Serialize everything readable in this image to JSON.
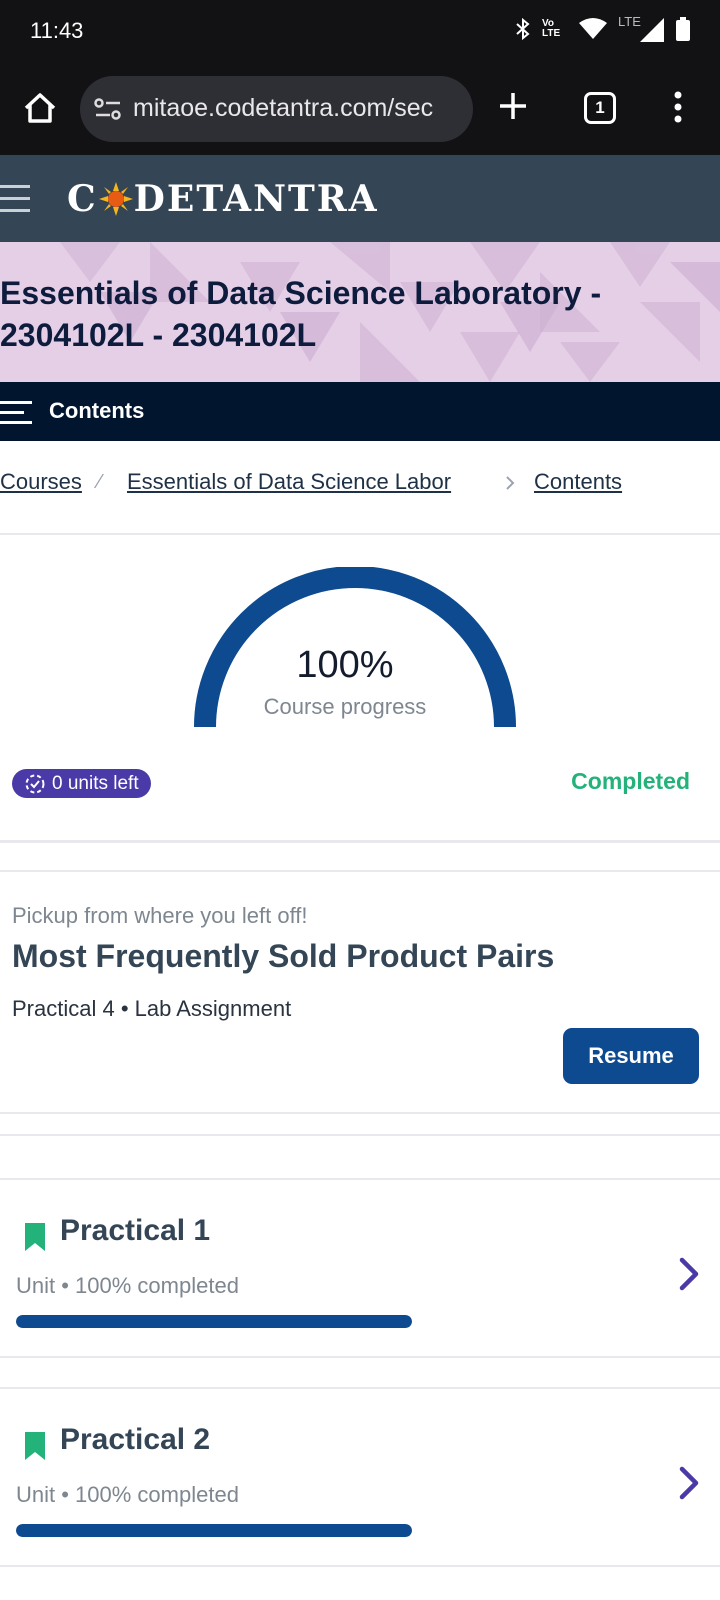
{
  "status_bar": {
    "time": "11:43",
    "icons": [
      "bluetooth-icon",
      "volte-icon",
      "wifi-icon",
      "lte-signal-icon",
      "battery-icon"
    ],
    "lte_label": "LTE",
    "volte_label": "Vo LTE"
  },
  "browser": {
    "url": "mitaoe.codetantra.com/sec",
    "tab_count": "1"
  },
  "app_header": {
    "logo_prefix": "C",
    "logo_suffix": "DETANTRA"
  },
  "course": {
    "title": "Essentials of Data Science Laboratory - 2304102L - 2304102L"
  },
  "contents_bar": {
    "label": "Contents"
  },
  "breadcrumb": [
    {
      "label": "Courses"
    },
    {
      "label": "Essentials of Data Science Labor"
    },
    {
      "label": "Contents"
    }
  ],
  "progress": {
    "value_text": "100%",
    "fraction": 1.0,
    "label": "Course progress",
    "units_left": "0 units left",
    "status": "Completed"
  },
  "pickup": {
    "hint": "Pickup from where you left off!",
    "title": "Most Frequently Sold Product Pairs",
    "meta": "Practical 4 • Lab Assignment",
    "resume_label": "Resume"
  },
  "units": [
    {
      "title": "Practical 1",
      "meta": "Unit • 100% completed",
      "progress": 1.0
    },
    {
      "title": "Practical 2",
      "meta": "Unit • 100% completed",
      "progress": 1.0
    }
  ],
  "colors": {
    "header_bg": "#344556",
    "banner_bg": "#e4cfe6",
    "contents_bg": "#02152f",
    "progress_blue": "#0d4a8f",
    "badge_purple": "#4a3aa7",
    "completed_green": "#22b27a",
    "bookmark_green": "#22b27a",
    "chevron_purple": "#4a3aa7"
  }
}
